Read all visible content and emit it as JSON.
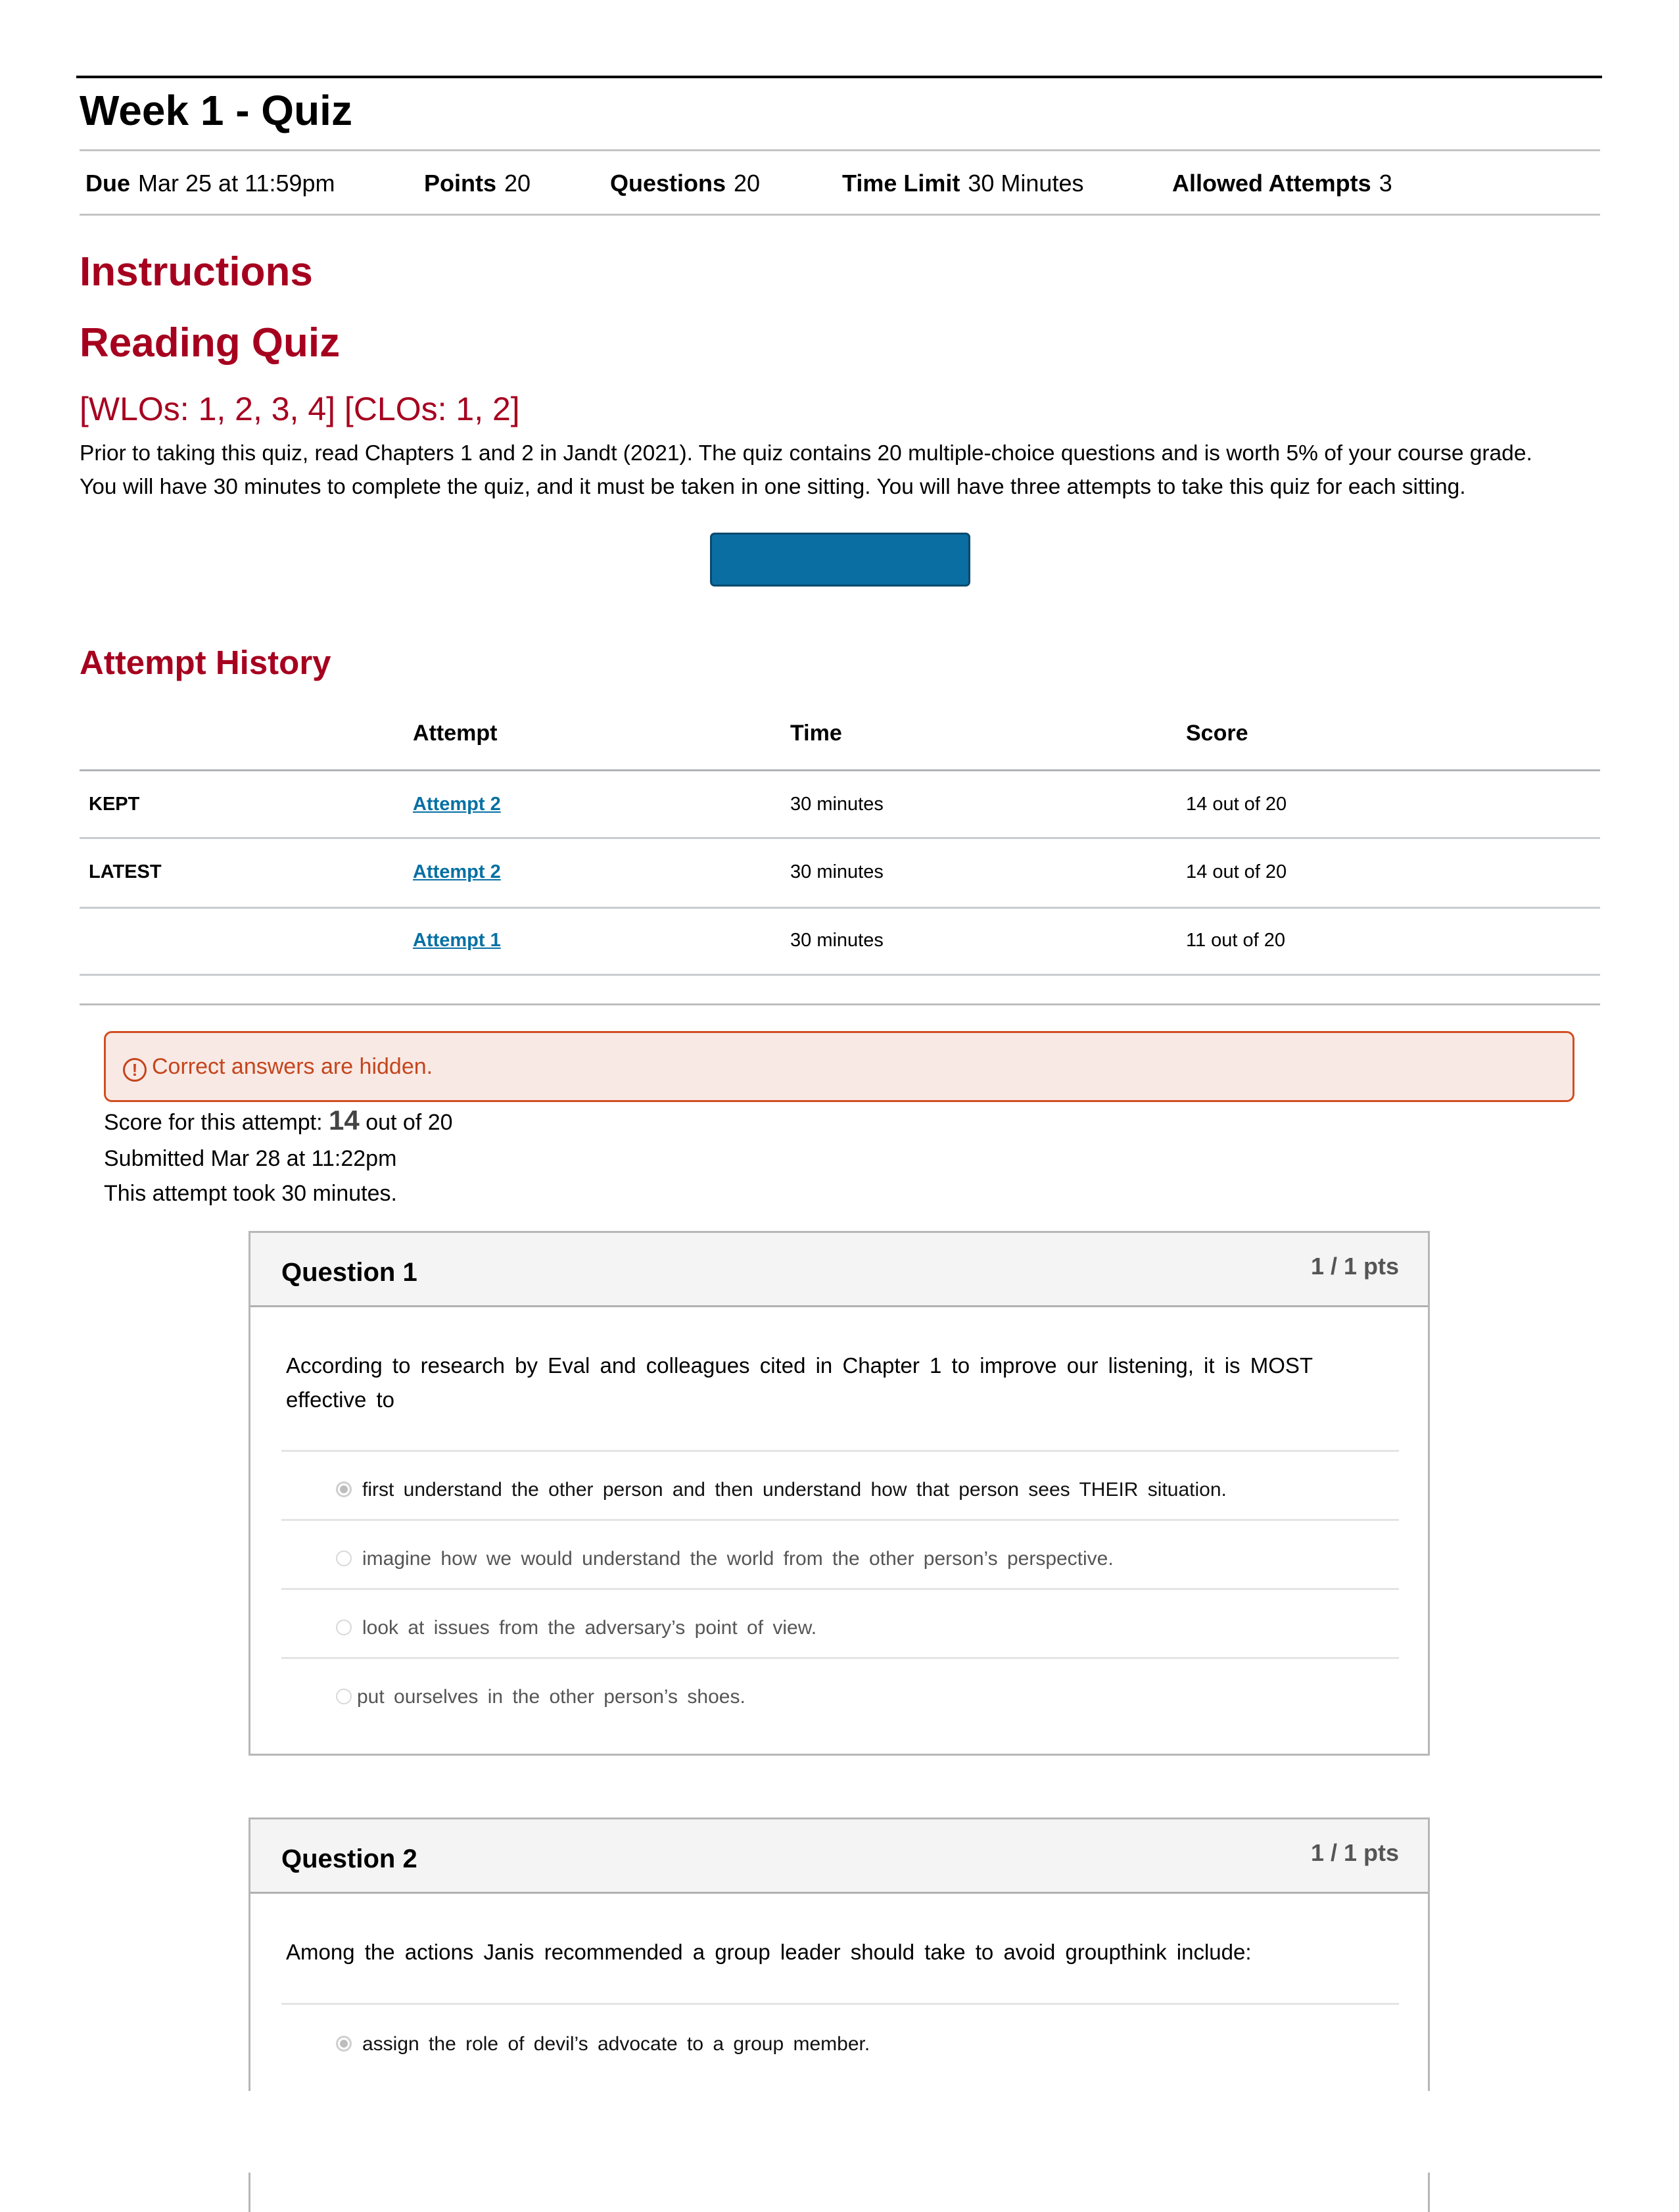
{
  "header": {
    "title": "Week 1 - Quiz",
    "meta": [
      {
        "label": "Due",
        "value": "Mar 25 at 11:59pm"
      },
      {
        "label": "Points",
        "value": "20"
      },
      {
        "label": "Questions",
        "value": "20"
      },
      {
        "label": "Time Limit",
        "value": "30 Minutes"
      },
      {
        "label": "Allowed Attempts",
        "value": "3"
      }
    ]
  },
  "instructions": {
    "heading": "Instructions",
    "subheading": "Reading Quiz",
    "outcomes": "[WLOs: 1, 2, 3, 4] [CLOs: 1, 2]",
    "paragraph_line1": "Prior to taking this quiz, read Chapters 1 and 2 in Jandt (2021). The quiz contains 20 multiple-choice questions and is worth 5% of your course grade.",
    "paragraph_line2": "You will have 30 minutes to complete the quiz, and it must be taken in one sitting. You will have three attempts to take this quiz for each sitting.",
    "primary_button_label": ""
  },
  "attempt_history": {
    "title": "Attempt History",
    "columns": [
      "",
      "Attempt",
      "Time",
      "Score"
    ],
    "rows": [
      {
        "label": "KEPT",
        "attempt": "Attempt 2",
        "time": "30 minutes",
        "score": "14 out of 20"
      },
      {
        "label": "LATEST",
        "attempt": "Attempt 2",
        "time": "30 minutes",
        "score": "14 out of 20"
      },
      {
        "label": "",
        "attempt": "Attempt 1",
        "time": "30 minutes",
        "score": "11 out of 20"
      }
    ]
  },
  "alert": {
    "icon": "warning-circle-icon",
    "text": "Correct answers are hidden.",
    "color": "#c4451c"
  },
  "attempt_summary": {
    "score_prefix": "Score for this attempt:",
    "score_value": "14",
    "score_suffix": "out of 20",
    "submitted": "Submitted Mar 28 at 11:22pm",
    "duration": "This attempt took 30 minutes."
  },
  "questions": [
    {
      "title": "Question 1",
      "points": "1 / 1 pts",
      "text_line1": "According  to  research  by   Eval  and colleagues  cited  in  Chapter  1  to  improve our  listening,  it is MOST",
      "text_line2": "effective  to",
      "answers": [
        {
          "text": "first  understand  the  other  person  and then  understand  how  that person  sees THEIR  situation.",
          "selected": true
        },
        {
          "text": "imagine  how  we  would  understand  the  world  from  the  other  person’s perspective.",
          "selected": false
        },
        {
          "text": "look  at  issues  from  the  adversary’s  point  of  view.",
          "selected": false
        },
        {
          "text": "put  ourselves  in  the  other  person’s  shoes.",
          "selected": false
        }
      ]
    },
    {
      "title": "Question 2",
      "points": "1 / 1 pts",
      "text_line1": "Among  the  actions  Janis  recommended  a group  leader  should  take  to  avoid groupthink  include:",
      "answers": [
        {
          "text": "assign  the  role  of  devil’s  advocate  to  a group  member.",
          "selected": true
        }
      ]
    }
  ],
  "colors": {
    "heading_red": "#a6001f",
    "link_blue": "#0770a3",
    "button_blue": "#0a6ea2",
    "alert_bg": "#f8e9e5",
    "alert_border": "#d24e22"
  }
}
